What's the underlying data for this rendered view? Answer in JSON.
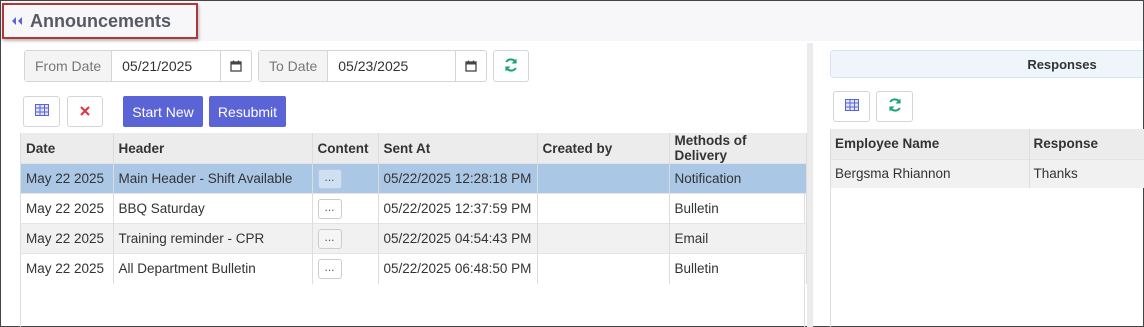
{
  "header": {
    "title": "Announcements",
    "back_icon": "double-chevron-left-icon"
  },
  "filters": {
    "from_label": "From Date",
    "from_value": "05/21/2025",
    "to_label": "To Date",
    "to_value": "05/23/2025"
  },
  "toolbar": {
    "start_new_label": "Start New",
    "resubmit_label": "Resubmit"
  },
  "announcements": {
    "columns": [
      "Date",
      "Header",
      "Content",
      "Sent At",
      "Created by",
      "Methods of Delivery"
    ],
    "content_button_label": "...",
    "rows": [
      {
        "date": "May 22 2025",
        "header": "Main Header - Shift Available",
        "sent_at": "05/22/2025 12:28:18 PM",
        "created_by": "",
        "method": "Notification"
      },
      {
        "date": "May 22 2025",
        "header": "BBQ Saturday",
        "sent_at": "05/22/2025 12:37:59 PM",
        "created_by": "",
        "method": "Bulletin"
      },
      {
        "date": "May 22 2025",
        "header": "Training reminder - CPR",
        "sent_at": "05/22/2025 04:54:43 PM",
        "created_by": "",
        "method": "Email"
      },
      {
        "date": "May 22 2025",
        "header": "All Department Bulletin",
        "sent_at": "05/22/2025 06:48:50 PM",
        "created_by": "",
        "method": "Bulletin"
      }
    ]
  },
  "responses": {
    "title": "Responses",
    "columns": [
      "Employee Name",
      "Response"
    ],
    "rows": [
      {
        "employee": "Bergsma Rhiannon",
        "response": "Thanks"
      }
    ]
  },
  "colors": {
    "primary": "#5b64d6",
    "refresh": "#1aa37a",
    "delete": "#e0333c",
    "selected_row": "#abc7e6",
    "title_border": "#b0383a"
  }
}
